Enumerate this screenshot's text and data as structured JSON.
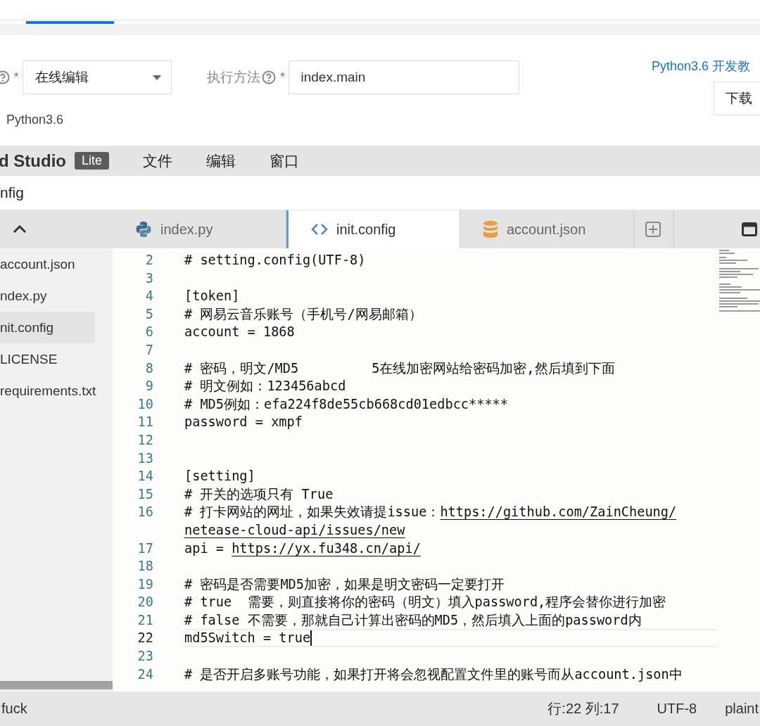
{
  "top_tabs": [
    {
      "selected": true
    }
  ],
  "form": {
    "required_marks": [
      "*",
      "*"
    ],
    "select_value": "在线编辑",
    "method_label": "执行方法",
    "method_value": "index.main",
    "help_link": "Python3.6 开发教",
    "download_button": "下载",
    "runtime": "Python3.6"
  },
  "ide": {
    "brand": "d Studio",
    "badge": "Lite",
    "menus": [
      "文件",
      "编辑",
      "窗口"
    ],
    "path": "nfig"
  },
  "sidebar": {
    "items": [
      {
        "label": "account.json",
        "selected": false
      },
      {
        "label": "ndex.py",
        "selected": false
      },
      {
        "label": "nit.config",
        "selected": true
      },
      {
        "label": "LICENSE",
        "selected": false
      },
      {
        "label": "requirements.txt",
        "selected": false
      }
    ]
  },
  "editor_tabs": [
    {
      "label": "index.py",
      "kind": "python",
      "selected": false
    },
    {
      "label": "init.config",
      "kind": "code",
      "selected": true
    },
    {
      "label": "account.json",
      "kind": "database",
      "selected": false
    }
  ],
  "code_lines": [
    {
      "number": "2",
      "current": false,
      "segments": [
        {
          "kind": "text",
          "text": "# setting.config(UTF-8)"
        }
      ]
    },
    {
      "number": "3",
      "current": false
    },
    {
      "number": "4",
      "current": false,
      "segments": [
        {
          "kind": "text",
          "text": "[token]"
        }
      ]
    },
    {
      "number": "5",
      "current": false,
      "segments": [
        {
          "kind": "text",
          "text": "# 网易云音乐账号（手机号/网易邮箱）"
        }
      ]
    },
    {
      "number": "6",
      "current": false,
      "segments": [
        {
          "kind": "text",
          "text": "account = 1868"
        }
      ]
    },
    {
      "number": "7",
      "current": false
    },
    {
      "number": "8",
      "current": false,
      "segments": [
        {
          "kind": "text",
          "text": "# 密码，明文/MD5"
        },
        {
          "kind": "gap"
        },
        {
          "kind": "text",
          "text": "5在线加密网站给密码加密,然后填到下面"
        }
      ]
    },
    {
      "number": "9",
      "current": false,
      "segments": [
        {
          "kind": "text",
          "text": "# 明文例如：123456abcd"
        }
      ]
    },
    {
      "number": "10",
      "current": false,
      "segments": [
        {
          "kind": "text",
          "text": "# MD5例如：efa224f8de55cb668cd01edbcc*****"
        }
      ]
    },
    {
      "number": "11",
      "current": false,
      "segments": [
        {
          "kind": "text",
          "text": "password = xmpf"
        }
      ]
    },
    {
      "number": "12",
      "current": false
    },
    {
      "number": "13",
      "current": false
    },
    {
      "number": "14",
      "current": false,
      "segments": [
        {
          "kind": "text",
          "text": "[setting]"
        }
      ]
    },
    {
      "number": "15",
      "current": false,
      "segments": [
        {
          "kind": "text",
          "text": "# 开关的选项只有 True"
        }
      ]
    },
    {
      "number": "16",
      "current": false,
      "segments": [
        {
          "kind": "text",
          "text": "# 打卡网站的网址，如果失效请提issue："
        },
        {
          "kind": "link",
          "text": "https://github.com/ZainCheung/"
        },
        {
          "kind": "break"
        },
        {
          "kind": "link",
          "text": "netease-cloud-api/issues/new"
        }
      ]
    },
    {
      "number": "17",
      "current": false,
      "segments": [
        {
          "kind": "text",
          "text": "api = "
        },
        {
          "kind": "link",
          "text": "https://yx.fu348.cn/api/"
        }
      ]
    },
    {
      "number": "18",
      "current": false
    },
    {
      "number": "19",
      "current": false,
      "segments": [
        {
          "kind": "text",
          "text": "# 密码是否需要MD5加密，如果是明文密码一定要打开"
        }
      ]
    },
    {
      "number": "20",
      "current": false,
      "segments": [
        {
          "kind": "text",
          "text": "# true  需要，则直接将你的密码（明文）填入password,程序会替你进行加密"
        }
      ]
    },
    {
      "number": "21",
      "current": false,
      "segments": [
        {
          "kind": "text",
          "text": "# false 不需要，那就自己计算出密码的MD5，然后填入上面的password内"
        }
      ]
    },
    {
      "number": "22",
      "current": true,
      "segments": [
        {
          "kind": "text",
          "text": "md5Switch = true"
        }
      ]
    },
    {
      "number": "23",
      "current": false
    },
    {
      "number": "24",
      "current": false,
      "segments": [
        {
          "kind": "text",
          "text": "# 是否开启多账号功能，如果打开将会忽视配置文件里的账号而从account.json中"
        }
      ]
    }
  ],
  "status_bar": {
    "left": "fuck",
    "position": "行:22 列:17",
    "encoding": "UTF-8",
    "mode": "plaint"
  }
}
